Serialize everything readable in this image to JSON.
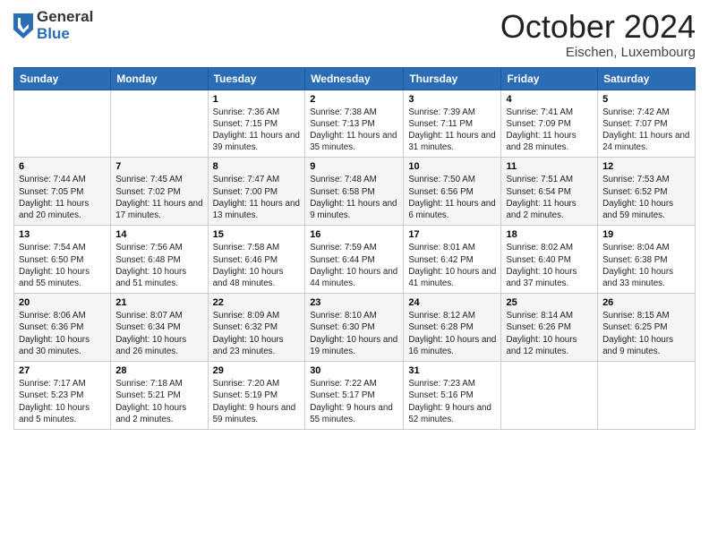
{
  "logo": {
    "general": "General",
    "blue": "Blue"
  },
  "title": "October 2024",
  "location": "Eischen, Luxembourg",
  "days_of_week": [
    "Sunday",
    "Monday",
    "Tuesday",
    "Wednesday",
    "Thursday",
    "Friday",
    "Saturday"
  ],
  "weeks": [
    [
      {
        "day": "",
        "info": ""
      },
      {
        "day": "",
        "info": ""
      },
      {
        "day": "1",
        "info": "Sunrise: 7:36 AM\nSunset: 7:15 PM\nDaylight: 11 hours and 39 minutes."
      },
      {
        "day": "2",
        "info": "Sunrise: 7:38 AM\nSunset: 7:13 PM\nDaylight: 11 hours and 35 minutes."
      },
      {
        "day": "3",
        "info": "Sunrise: 7:39 AM\nSunset: 7:11 PM\nDaylight: 11 hours and 31 minutes."
      },
      {
        "day": "4",
        "info": "Sunrise: 7:41 AM\nSunset: 7:09 PM\nDaylight: 11 hours and 28 minutes."
      },
      {
        "day": "5",
        "info": "Sunrise: 7:42 AM\nSunset: 7:07 PM\nDaylight: 11 hours and 24 minutes."
      }
    ],
    [
      {
        "day": "6",
        "info": "Sunrise: 7:44 AM\nSunset: 7:05 PM\nDaylight: 11 hours and 20 minutes."
      },
      {
        "day": "7",
        "info": "Sunrise: 7:45 AM\nSunset: 7:02 PM\nDaylight: 11 hours and 17 minutes."
      },
      {
        "day": "8",
        "info": "Sunrise: 7:47 AM\nSunset: 7:00 PM\nDaylight: 11 hours and 13 minutes."
      },
      {
        "day": "9",
        "info": "Sunrise: 7:48 AM\nSunset: 6:58 PM\nDaylight: 11 hours and 9 minutes."
      },
      {
        "day": "10",
        "info": "Sunrise: 7:50 AM\nSunset: 6:56 PM\nDaylight: 11 hours and 6 minutes."
      },
      {
        "day": "11",
        "info": "Sunrise: 7:51 AM\nSunset: 6:54 PM\nDaylight: 11 hours and 2 minutes."
      },
      {
        "day": "12",
        "info": "Sunrise: 7:53 AM\nSunset: 6:52 PM\nDaylight: 10 hours and 59 minutes."
      }
    ],
    [
      {
        "day": "13",
        "info": "Sunrise: 7:54 AM\nSunset: 6:50 PM\nDaylight: 10 hours and 55 minutes."
      },
      {
        "day": "14",
        "info": "Sunrise: 7:56 AM\nSunset: 6:48 PM\nDaylight: 10 hours and 51 minutes."
      },
      {
        "day": "15",
        "info": "Sunrise: 7:58 AM\nSunset: 6:46 PM\nDaylight: 10 hours and 48 minutes."
      },
      {
        "day": "16",
        "info": "Sunrise: 7:59 AM\nSunset: 6:44 PM\nDaylight: 10 hours and 44 minutes."
      },
      {
        "day": "17",
        "info": "Sunrise: 8:01 AM\nSunset: 6:42 PM\nDaylight: 10 hours and 41 minutes."
      },
      {
        "day": "18",
        "info": "Sunrise: 8:02 AM\nSunset: 6:40 PM\nDaylight: 10 hours and 37 minutes."
      },
      {
        "day": "19",
        "info": "Sunrise: 8:04 AM\nSunset: 6:38 PM\nDaylight: 10 hours and 33 minutes."
      }
    ],
    [
      {
        "day": "20",
        "info": "Sunrise: 8:06 AM\nSunset: 6:36 PM\nDaylight: 10 hours and 30 minutes."
      },
      {
        "day": "21",
        "info": "Sunrise: 8:07 AM\nSunset: 6:34 PM\nDaylight: 10 hours and 26 minutes."
      },
      {
        "day": "22",
        "info": "Sunrise: 8:09 AM\nSunset: 6:32 PM\nDaylight: 10 hours and 23 minutes."
      },
      {
        "day": "23",
        "info": "Sunrise: 8:10 AM\nSunset: 6:30 PM\nDaylight: 10 hours and 19 minutes."
      },
      {
        "day": "24",
        "info": "Sunrise: 8:12 AM\nSunset: 6:28 PM\nDaylight: 10 hours and 16 minutes."
      },
      {
        "day": "25",
        "info": "Sunrise: 8:14 AM\nSunset: 6:26 PM\nDaylight: 10 hours and 12 minutes."
      },
      {
        "day": "26",
        "info": "Sunrise: 8:15 AM\nSunset: 6:25 PM\nDaylight: 10 hours and 9 minutes."
      }
    ],
    [
      {
        "day": "27",
        "info": "Sunrise: 7:17 AM\nSunset: 5:23 PM\nDaylight: 10 hours and 5 minutes."
      },
      {
        "day": "28",
        "info": "Sunrise: 7:18 AM\nSunset: 5:21 PM\nDaylight: 10 hours and 2 minutes."
      },
      {
        "day": "29",
        "info": "Sunrise: 7:20 AM\nSunset: 5:19 PM\nDaylight: 9 hours and 59 minutes."
      },
      {
        "day": "30",
        "info": "Sunrise: 7:22 AM\nSunset: 5:17 PM\nDaylight: 9 hours and 55 minutes."
      },
      {
        "day": "31",
        "info": "Sunrise: 7:23 AM\nSunset: 5:16 PM\nDaylight: 9 hours and 52 minutes."
      },
      {
        "day": "",
        "info": ""
      },
      {
        "day": "",
        "info": ""
      }
    ]
  ]
}
